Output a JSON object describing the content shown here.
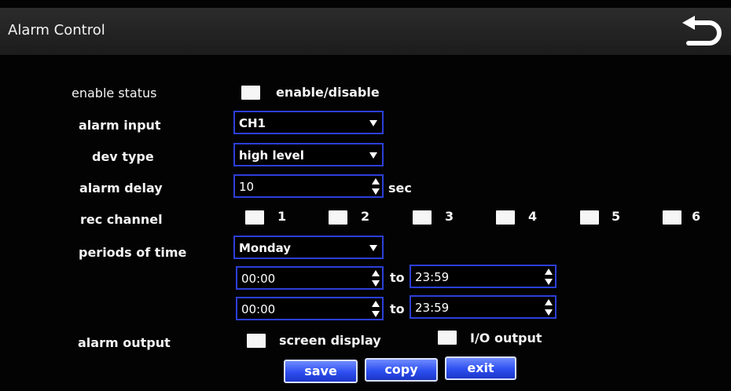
{
  "window": {
    "title": "Alarm Control",
    "back_icon": "back-arrow-icon"
  },
  "enable_status": {
    "label": "enable status",
    "checkbox_text": "enable/disable",
    "checked": false
  },
  "alarm_input": {
    "label": "alarm input",
    "value": "CH1"
  },
  "dev_type": {
    "label": "dev type",
    "value": "high level"
  },
  "alarm_delay": {
    "label": "alarm delay",
    "value": "10",
    "unit": "sec"
  },
  "rec_channel": {
    "label": "rec channel",
    "channels": [
      {
        "text": "1",
        "checked": false
      },
      {
        "text": "2",
        "checked": false
      },
      {
        "text": "3",
        "checked": false
      },
      {
        "text": "4",
        "checked": false
      },
      {
        "text": "5",
        "checked": false
      },
      {
        "text": "6",
        "checked": false
      }
    ]
  },
  "periods": {
    "label": "periods of time",
    "day": "Monday",
    "ranges": [
      {
        "start": "00:00",
        "to": "to",
        "end": "23:59"
      },
      {
        "start": "00:00",
        "to": "to",
        "end": "23:59"
      }
    ]
  },
  "alarm_output": {
    "label": "alarm output",
    "screen_display": "screen display",
    "io_output": "I/O output"
  },
  "buttons": {
    "save": "save",
    "copy": "copy",
    "exit": "exit"
  },
  "colors": {
    "field_border": "#2c3fd8",
    "button_top": "#6f8bff",
    "button_bottom": "#1c37c8"
  }
}
